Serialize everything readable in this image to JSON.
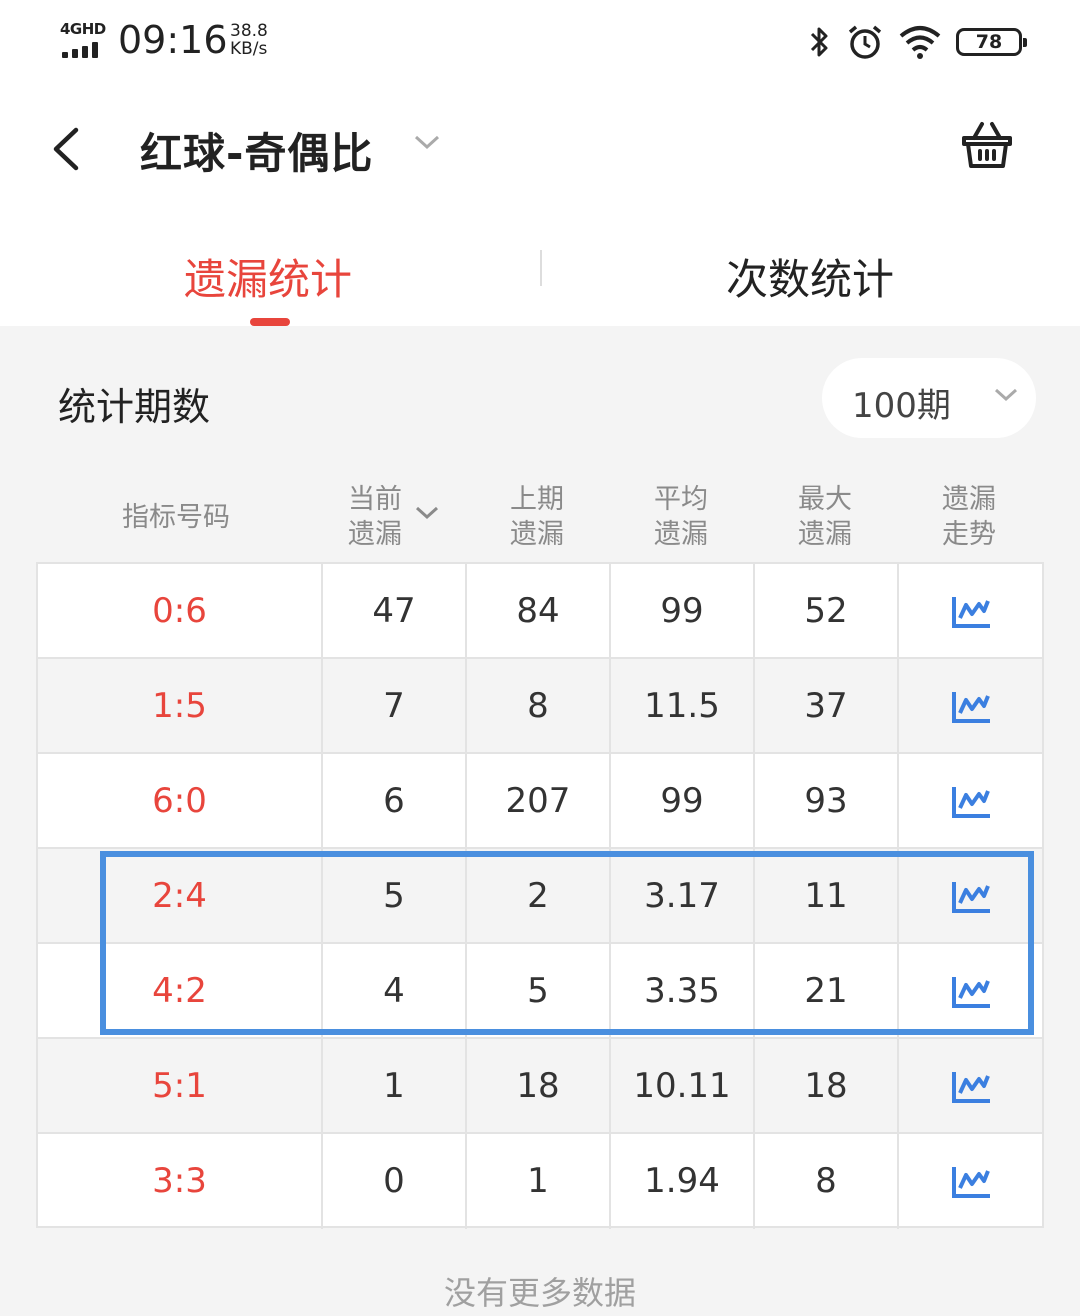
{
  "status_bar": {
    "network": "4GHD",
    "time": "09:16",
    "speed_value": "38.8",
    "speed_unit": "KB/s",
    "battery": "78"
  },
  "header": {
    "title": "红球-奇偶比",
    "back_icon": "back-arrow-icon",
    "dropdown_icon": "chevron-down-icon",
    "basket_icon": "basket-icon"
  },
  "tabs": [
    {
      "label": "遗漏统计",
      "active": true
    },
    {
      "label": "次数统计",
      "active": false
    }
  ],
  "period": {
    "label": "统计期数",
    "value": "100期"
  },
  "table": {
    "headers": [
      {
        "line1": "指标号码",
        "line2": ""
      },
      {
        "line1": "当前",
        "line2": "遗漏"
      },
      {
        "line1": "上期",
        "line2": "遗漏"
      },
      {
        "line1": "平均",
        "line2": "遗漏"
      },
      {
        "line1": "最大",
        "line2": "遗漏"
      },
      {
        "line1": "遗漏",
        "line2": "走势"
      }
    ],
    "rows": [
      {
        "ratio": "0:6",
        "current": "47",
        "last": "84",
        "avg": "99",
        "max": "52"
      },
      {
        "ratio": "1:5",
        "current": "7",
        "last": "8",
        "avg": "11.5",
        "max": "37"
      },
      {
        "ratio": "6:0",
        "current": "6",
        "last": "207",
        "avg": "99",
        "max": "93"
      },
      {
        "ratio": "2:4",
        "current": "5",
        "last": "2",
        "avg": "3.17",
        "max": "11"
      },
      {
        "ratio": "4:2",
        "current": "4",
        "last": "5",
        "avg": "3.35",
        "max": "21"
      },
      {
        "ratio": "5:1",
        "current": "1",
        "last": "18",
        "avg": "10.11",
        "max": "18"
      },
      {
        "ratio": "3:3",
        "current": "0",
        "last": "1",
        "avg": "1.94",
        "max": "8"
      }
    ],
    "trend_icon": "trend-chart-icon"
  },
  "footer": "没有更多数据",
  "colors": {
    "accent_red": "#e8453c",
    "trend_blue": "#3b7fe0",
    "highlight_blue": "#4a8fdf"
  }
}
